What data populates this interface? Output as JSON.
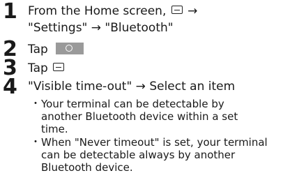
{
  "steps": [
    {
      "number": "1",
      "line1_prefix": "From the Home screen,",
      "line1_arrow": "→",
      "line2": "\"Settings\" → \"Bluetooth\"",
      "icon": "menu-icon"
    },
    {
      "number": "2",
      "text": "Tap",
      "icon": "toggle-icon"
    },
    {
      "number": "3",
      "text": "Tap",
      "icon": "menu-icon"
    },
    {
      "number": "4",
      "text": "\"Visible time-out\" → Select an item",
      "bullets": [
        {
          "marker": "・",
          "lines": [
            "Your terminal can be detectable by",
            "another Bluetooth device within a set",
            "time."
          ]
        },
        {
          "marker": "・",
          "lines": [
            "When \"Never timeout\" is set, your terminal",
            "can be detectable always by another",
            "Bluetooth device."
          ]
        }
      ]
    }
  ]
}
